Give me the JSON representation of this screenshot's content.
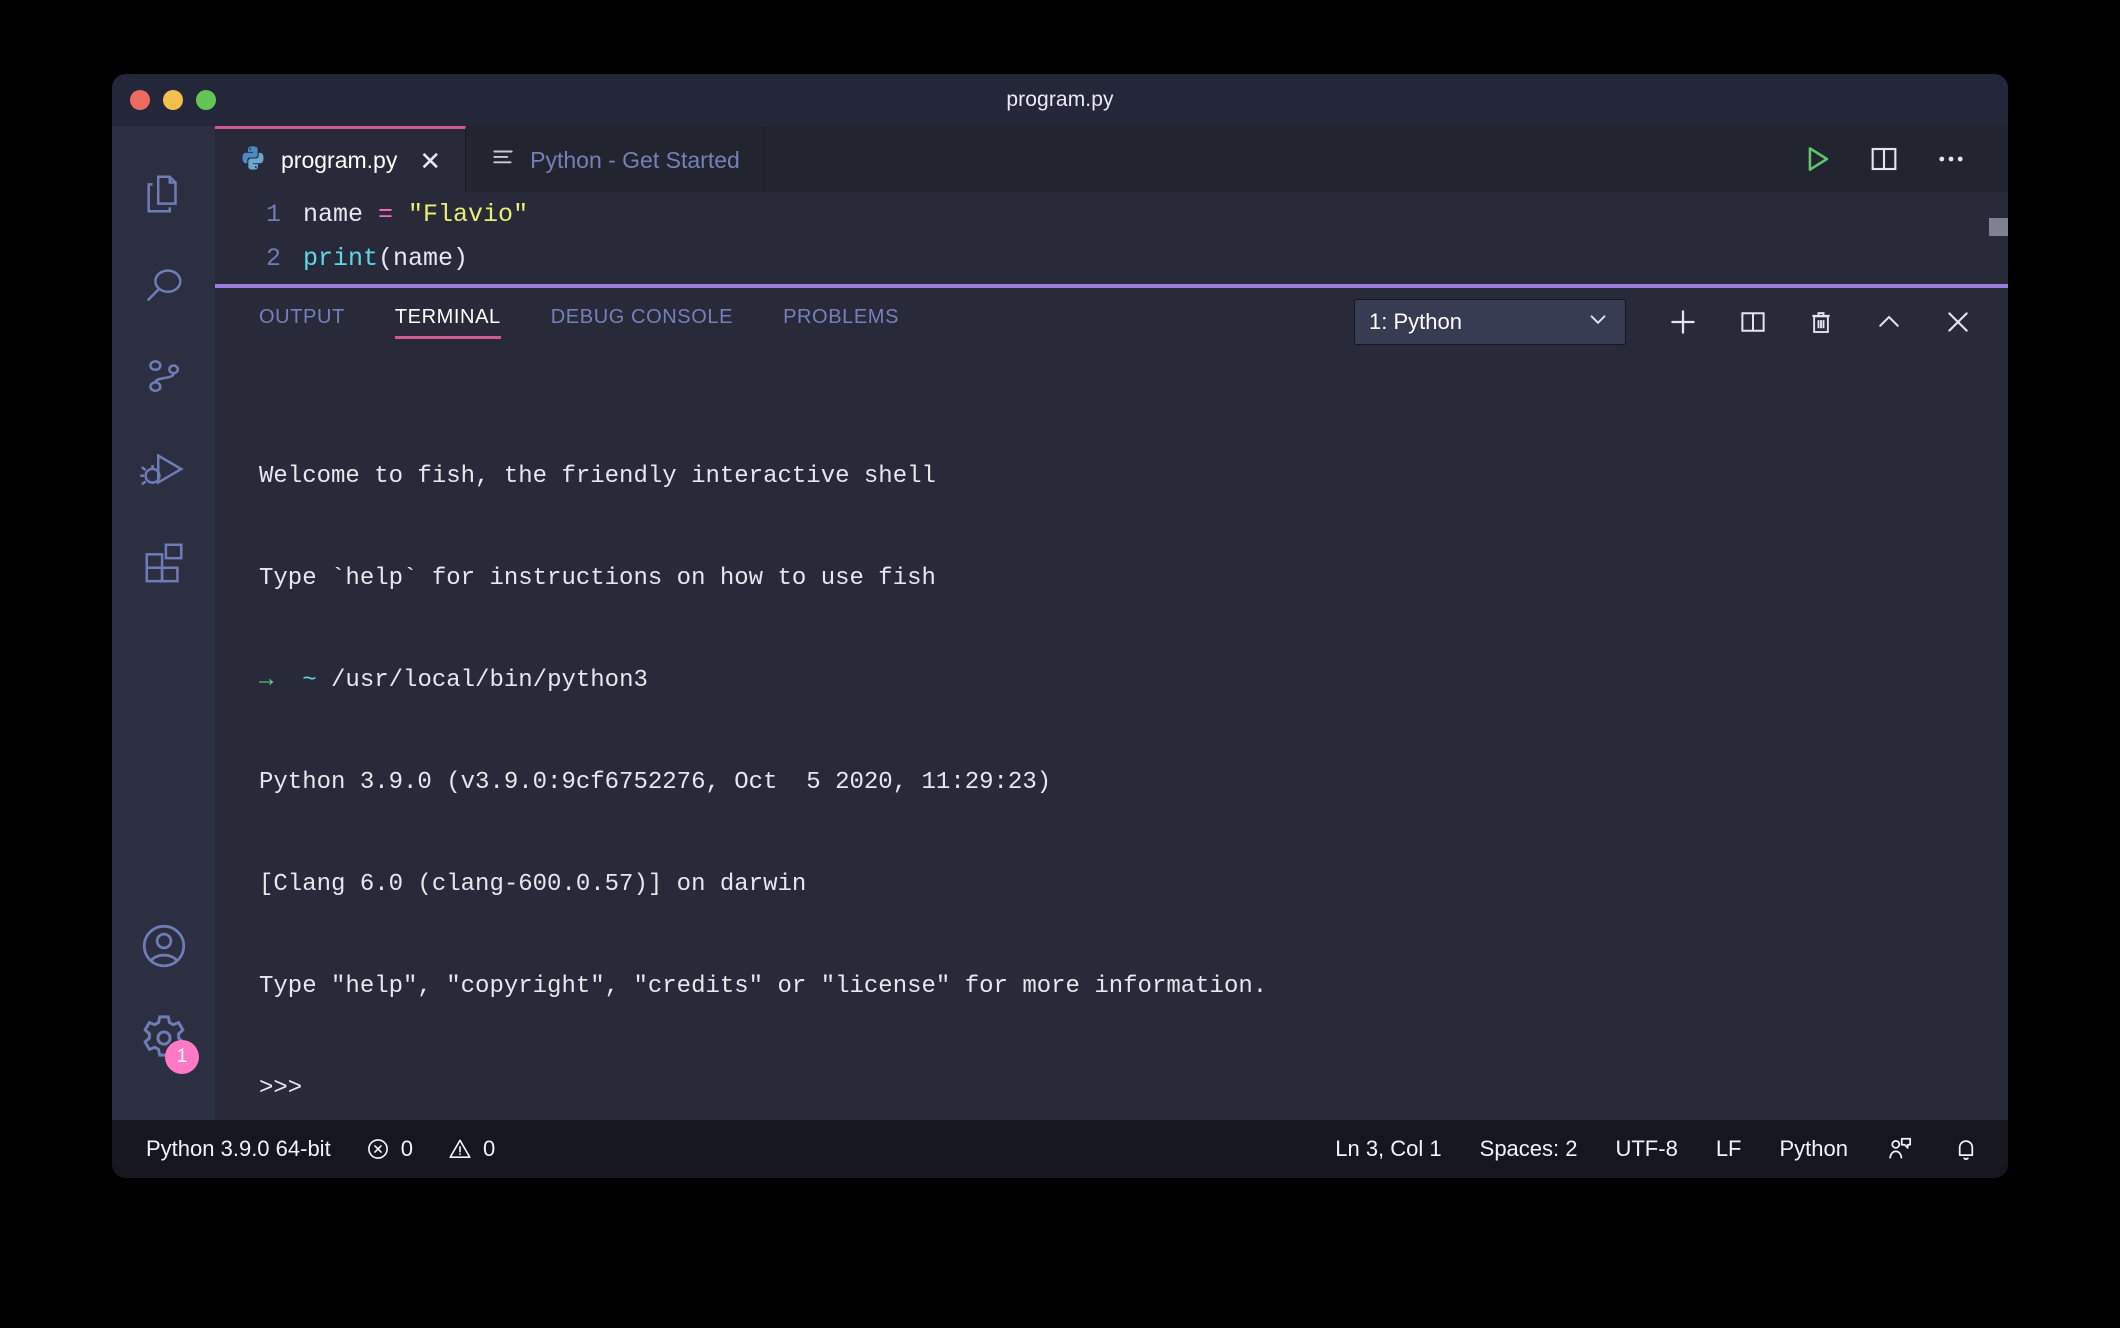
{
  "window": {
    "title": "program.py",
    "traffic_lights": [
      "close-red",
      "minimize-yellow",
      "zoom-green"
    ]
  },
  "tabs": [
    {
      "label": "program.py",
      "icon": "python-file-icon",
      "close": "✕",
      "active": true
    },
    {
      "label": "Python - Get Started",
      "icon": "walkthrough-lines-icon",
      "active": false
    }
  ],
  "editor_actions": [
    {
      "name": "run-python-file-icon",
      "label": "Run Python File"
    },
    {
      "name": "split-editor-icon",
      "label": "Split Editor"
    },
    {
      "name": "more-actions-icon",
      "label": "…"
    }
  ],
  "activitybar": {
    "items": [
      {
        "name": "explorer-icon",
        "label": "Explorer"
      },
      {
        "name": "search-icon",
        "label": "Search"
      },
      {
        "name": "source-control-icon",
        "label": "Source Control"
      },
      {
        "name": "run-and-debug-icon",
        "label": "Run and Debug"
      },
      {
        "name": "extensions-icon",
        "label": "Extensions"
      }
    ],
    "bottom": [
      {
        "name": "accounts-icon",
        "label": "Accounts"
      },
      {
        "name": "settings-gear-icon",
        "label": "Manage",
        "badge": "1"
      }
    ]
  },
  "editor": {
    "lines": [
      {
        "number": "1",
        "tokens": [
          {
            "t": "name ",
            "c": "plain"
          },
          {
            "t": "=",
            "c": "op"
          },
          {
            "t": " ",
            "c": "plain"
          },
          {
            "t": "\"Flavio\"",
            "c": "str"
          }
        ]
      },
      {
        "number": "2",
        "tokens": [
          {
            "t": "print",
            "c": "fn"
          },
          {
            "t": "(name)",
            "c": "plain"
          }
        ]
      }
    ]
  },
  "panel": {
    "tabs": [
      {
        "label": "OUTPUT",
        "active": false
      },
      {
        "label": "TERMINAL",
        "active": true
      },
      {
        "label": "DEBUG CONSOLE",
        "active": false
      },
      {
        "label": "PROBLEMS",
        "active": false
      }
    ],
    "terminal_select": {
      "value": "1: Python",
      "chevron": "⌄"
    },
    "actions": [
      {
        "name": "new-terminal-icon",
        "label": "New Terminal"
      },
      {
        "name": "split-terminal-icon",
        "label": "Split Terminal"
      },
      {
        "name": "kill-terminal-icon",
        "label": "Kill Terminal"
      },
      {
        "name": "maximize-panel-icon",
        "label": "Maximize Panel"
      },
      {
        "name": "close-panel-icon",
        "label": "Close Panel"
      }
    ],
    "terminal_lines": [
      [
        {
          "t": "Welcome to fish, the friendly interactive shell",
          "c": "plain"
        }
      ],
      [
        {
          "t": "Type `help` for instructions on how to use fish",
          "c": "plain"
        }
      ],
      [
        {
          "t": "→",
          "c": "green"
        },
        {
          "t": "  ",
          "c": "plain"
        },
        {
          "t": "~",
          "c": "cyan"
        },
        {
          "t": " /usr/local/bin/python3",
          "c": "plain"
        }
      ],
      [
        {
          "t": "Python 3.9.0 (v3.9.0:9cf6752276, Oct  5 2020, 11:29:23)",
          "c": "plain"
        }
      ],
      [
        {
          "t": "[Clang 6.0 (clang-600.0.57)] on darwin",
          "c": "plain"
        }
      ],
      [
        {
          "t": "Type \"help\", \"copyright\", \"credits\" or \"license\" for more information.",
          "c": "plain"
        }
      ],
      [
        {
          "t": ">>>",
          "c": "plain"
        }
      ]
    ]
  },
  "statusbar": {
    "left": [
      {
        "name": "python-interpreter",
        "label": "Python 3.9.0 64-bit",
        "icon": null
      },
      {
        "name": "errors-count",
        "label": "0",
        "icon": "error-circle-icon"
      },
      {
        "name": "warnings-count",
        "label": "0",
        "icon": "warning-triangle-icon"
      }
    ],
    "right": [
      {
        "name": "cursor-position",
        "label": "Ln 3, Col 1"
      },
      {
        "name": "indentation",
        "label": "Spaces: 2"
      },
      {
        "name": "encoding",
        "label": "UTF-8"
      },
      {
        "name": "eol",
        "label": "LF"
      },
      {
        "name": "language-mode",
        "label": "Python"
      },
      {
        "name": "feedback-icon",
        "label": ""
      },
      {
        "name": "notifications-bell-icon",
        "label": ""
      }
    ]
  },
  "colors": {
    "accent_pink": "#d05a92",
    "panel_border_purple": "#9d7ddc",
    "badge_pink": "#ff79c6",
    "run_green": "#5ec46b",
    "editor_bg": "#282a3a",
    "activitybar_bg": "#2c2f42",
    "statusbar_bg": "#16161f"
  }
}
